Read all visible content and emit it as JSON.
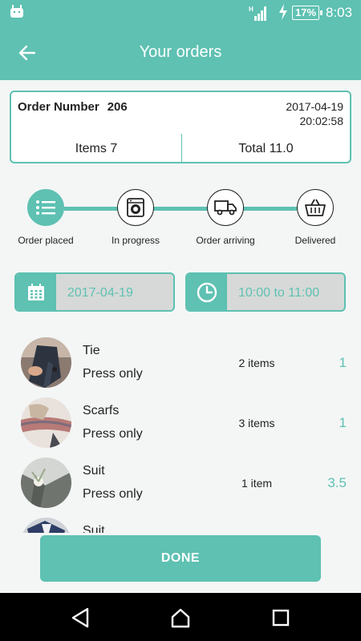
{
  "status_bar": {
    "battery": "17%",
    "time": "8:03",
    "network": "H"
  },
  "app_bar": {
    "title": "Your orders"
  },
  "order": {
    "number_label": "Order Number",
    "number": "206",
    "date": "2017-04-19",
    "time": "20:02:58",
    "items": "Items 7",
    "total": "Total 11.0"
  },
  "progress": {
    "steps": [
      {
        "label": "Order placed",
        "icon": "list-icon",
        "active": true
      },
      {
        "label": "In progress",
        "icon": "washing-machine-icon",
        "active": false
      },
      {
        "label": "Order arriving",
        "icon": "truck-icon",
        "active": false
      },
      {
        "label": "Delivered",
        "icon": "basket-icon",
        "active": false
      }
    ]
  },
  "schedule": {
    "date": "2017-04-19",
    "time_slot": "10:00 to 11:00"
  },
  "items": [
    {
      "name": "Tie",
      "service": "Press only",
      "count": "2 items",
      "price": "1"
    },
    {
      "name": "Scarfs",
      "service": "Press only",
      "count": "3 items",
      "price": "1"
    },
    {
      "name": "Suit",
      "service": "Press only",
      "count": "1 item",
      "price": "3.5"
    },
    {
      "name": "Suit",
      "service": "",
      "count": "",
      "price": ""
    }
  ],
  "actions": {
    "done_label": "DONE"
  },
  "colors": {
    "accent": "#5ec1b2",
    "picker_bg": "#d6d9d8",
    "background": "#f4f6f6"
  }
}
